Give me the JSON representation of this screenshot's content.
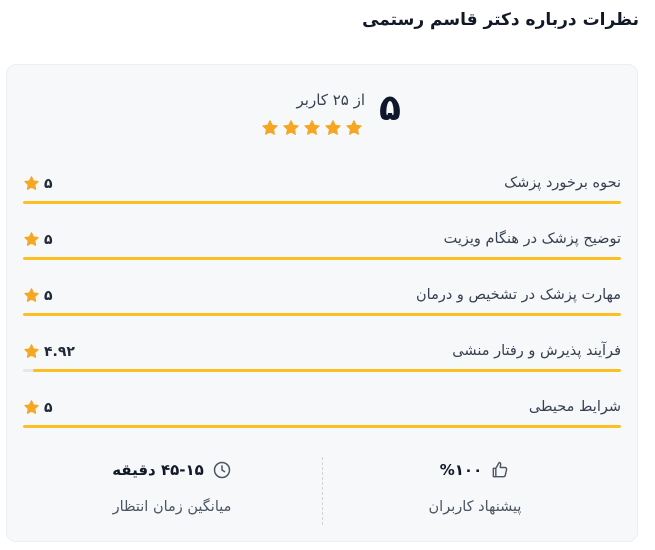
{
  "page": {
    "title": "نظرات درباره دکتر قاسم رستمی"
  },
  "summary": {
    "score": "۵",
    "review_count": "از ۲۵ کاربر",
    "stars": 5
  },
  "ratings": [
    {
      "label": "نحوه برخورد پزشک",
      "value": "۵",
      "fraction": 1.0
    },
    {
      "label": "توضیح پزشک در هنگام ویزیت",
      "value": "۵",
      "fraction": 1.0
    },
    {
      "label": "مهارت پزشک در تشخیص و درمان",
      "value": "۵",
      "fraction": 1.0
    },
    {
      "label": "فرآیند پذیرش و رفتار منشی",
      "value": "۴.۹۲",
      "fraction": 0.984
    },
    {
      "label": "شرایط محیطی",
      "value": "۵",
      "fraction": 1.0
    }
  ],
  "stats": {
    "wait_time": {
      "value": "۴۵-۱۵ دقیقه",
      "label": "میانگین زمان انتظار",
      "icon": "clock-icon"
    },
    "recommend": {
      "value": "%۱۰۰",
      "label": "پیشنهاد کاربران",
      "icon": "thumbs-up-icon"
    }
  },
  "colors": {
    "star": "#f5a623",
    "bar": "#fbbf24",
    "track": "#e5e7eb"
  }
}
